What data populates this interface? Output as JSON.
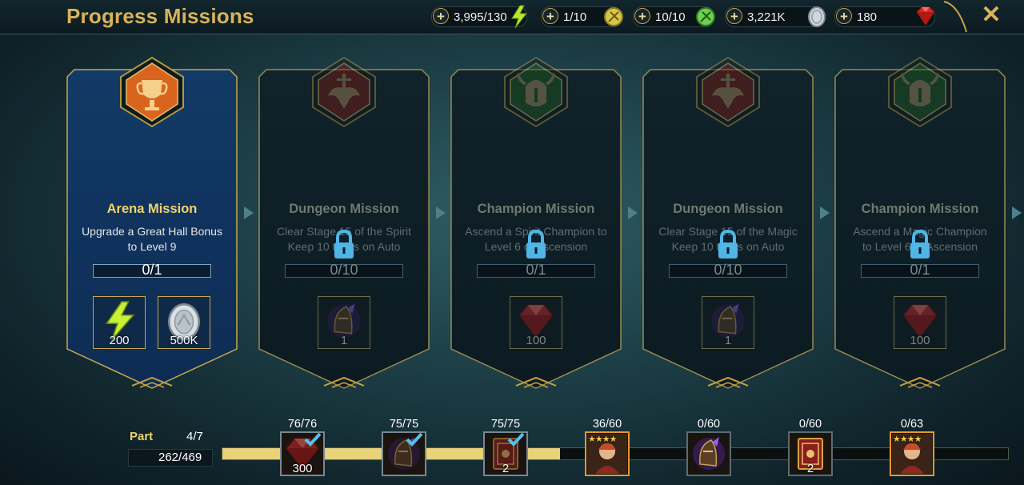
{
  "header": {
    "title": "Progress Missions",
    "close_icon": "close-icon",
    "resources": [
      {
        "value": "3,995/130",
        "icon": "energy-icon"
      },
      {
        "value": "1/10",
        "icon": "arena-token-icon"
      },
      {
        "value": "10/10",
        "icon": "classic-arena-token-icon"
      },
      {
        "value": "3,221K",
        "icon": "silver-coin-icon"
      },
      {
        "value": "180",
        "icon": "gem-icon"
      }
    ]
  },
  "missions": [
    {
      "name": "Arena Mission",
      "description": "Upgrade a Great Hall Bonus to Level 9",
      "progress": "0/1",
      "locked": false,
      "rewards": [
        {
          "label": "200",
          "icon": "energy-icon"
        },
        {
          "label": "500K",
          "icon": "silver-coin-icon"
        }
      ]
    },
    {
      "name": "Dungeon Mission",
      "description": "Clear Stage 15 of the Spirit Keep 10 times on Auto",
      "progress": "0/10",
      "locked": true,
      "rewards": [
        {
          "label": "1",
          "icon": "artifact-helmet-icon"
        }
      ]
    },
    {
      "name": "Champion Mission",
      "description": "Ascend a Spirit Champion to Level 6 of Ascension",
      "progress": "0/1",
      "locked": true,
      "rewards": [
        {
          "label": "100",
          "icon": "gem-icon"
        }
      ]
    },
    {
      "name": "Dungeon Mission",
      "description": "Clear Stage 15 of the Magic Keep 10 times on Auto",
      "progress": "0/10",
      "locked": true,
      "rewards": [
        {
          "label": "1",
          "icon": "artifact-helmet-icon"
        }
      ]
    },
    {
      "name": "Champion Mission",
      "description": "Ascend a Magic Champion to Level 6 of Ascension",
      "progress": "0/1",
      "locked": true,
      "rewards": [
        {
          "label": "100",
          "icon": "gem-icon"
        }
      ]
    }
  ],
  "part": {
    "label": "Part",
    "value": "4/7",
    "points": "262/469",
    "fill_fraction": 0.43
  },
  "milestones": [
    {
      "count": "76/76",
      "label": "300",
      "icon": "gem-icon",
      "completed": true
    },
    {
      "count": "75/75",
      "label": "",
      "icon": "artifact-helmet-icon",
      "completed": true
    },
    {
      "count": "75/75",
      "label": "2",
      "icon": "tome-icon",
      "completed": true
    },
    {
      "count": "36/60",
      "label": "",
      "icon": "champion-portrait-icon",
      "completed": false,
      "stars": "★★★★"
    },
    {
      "count": "0/60",
      "label": "",
      "icon": "artifact-helmet-icon",
      "completed": false
    },
    {
      "count": "0/60",
      "label": "2",
      "icon": "tome-icon",
      "completed": false
    },
    {
      "count": "0/63",
      "label": "",
      "icon": "champion-portrait-icon",
      "completed": false,
      "stars": "★★★★"
    }
  ]
}
